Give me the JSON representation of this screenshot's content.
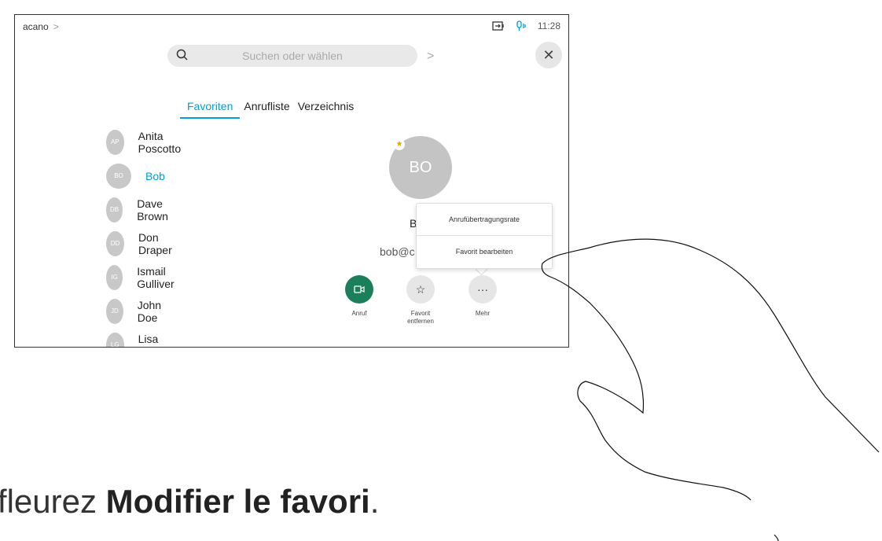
{
  "topbar": {
    "title": "acano",
    "time": "11:28"
  },
  "search": {
    "placeholder": "Suchen oder wählen"
  },
  "tabs": [
    {
      "label": "Favoriten",
      "active": true
    },
    {
      "label": "Anrufliste",
      "active": false
    },
    {
      "label": "Verzeichnis",
      "active": false
    }
  ],
  "contacts": [
    {
      "initials": "AP",
      "name": "Anita Poscotto"
    },
    {
      "initials": "BO",
      "name": "Bob",
      "selected": true
    },
    {
      "initials": "DB",
      "name": "Dave Brown"
    },
    {
      "initials": "DD",
      "name": "Don Draper"
    },
    {
      "initials": "IG",
      "name": "Ismail Gulliver"
    },
    {
      "initials": "JD",
      "name": "John Doe"
    },
    {
      "initials": "LG",
      "name": "Lisa Green"
    }
  ],
  "detail": {
    "initials": "BO",
    "name": "B",
    "email": "bob@c"
  },
  "popup": {
    "item1": "Anrufübertragungsrate",
    "item2": "Favorit bearbeiten"
  },
  "actions": {
    "call": "Anruf",
    "favorite_line1": "Favorit",
    "favorite_line2": "entfernen",
    "more": "Mehr"
  },
  "caption": {
    "prefix": "ffleurez ",
    "bold": "Modifier le favori",
    "suffix": "."
  },
  "colors": {
    "accent": "#00a0d1",
    "call_green": "#1b7f5b"
  }
}
